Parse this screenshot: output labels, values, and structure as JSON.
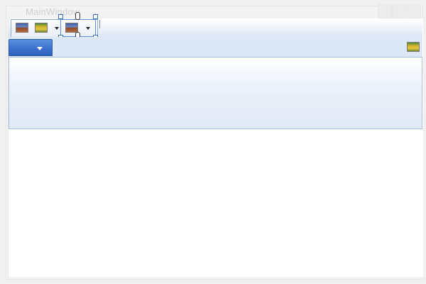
{
  "window": {
    "title": "MainWindow"
  },
  "title_bar": {
    "buttons": [
      "minimize-button",
      "maximize-button",
      "close-button"
    ]
  },
  "quick_access_toolbar": {
    "items": [
      {
        "name": "image-button-1",
        "icon": "landscape-picture-icon"
      },
      {
        "name": "image-button-2",
        "icon": "flowers-picture-icon",
        "has_dropdown": true
      },
      {
        "name": "image-button-3",
        "icon": "landscape-picture-icon",
        "has_dropdown": true,
        "selected": true
      }
    ]
  },
  "ribbon": {
    "application_button": {
      "icon": "triangle-down-icon",
      "color": "#3f74cf"
    },
    "help_icon": "flowers-picture-icon"
  },
  "colors": {
    "ribbon_background": "#dde8f6",
    "selection": "#5b8fd8",
    "app_button": "#3f74cf"
  }
}
